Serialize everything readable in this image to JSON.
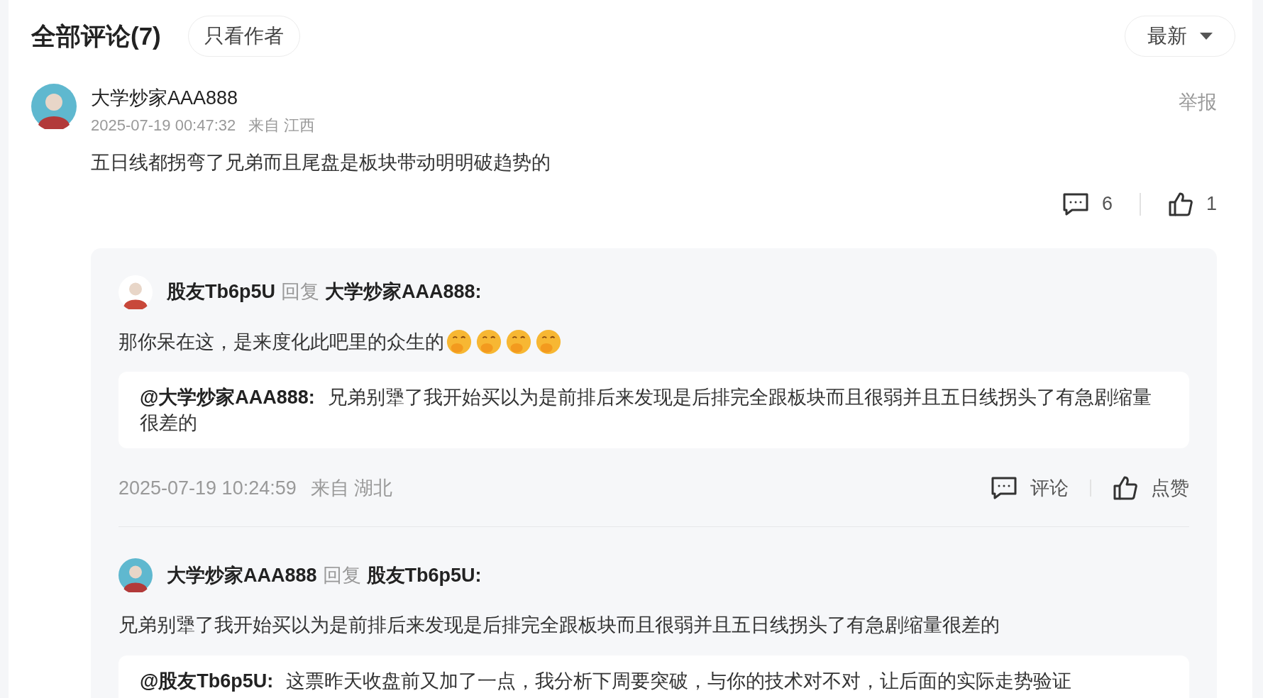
{
  "header": {
    "title": "全部评论(7)",
    "filter_button": "只看作者",
    "sort_button": "最新"
  },
  "comment": {
    "avatar": {
      "kind": "elder"
    },
    "author": "大学炒家AAA888",
    "time": "2025-07-19 00:47:32",
    "location": "来自 江西",
    "report": "举报",
    "text": "五日线都拐弯了兄弟而且尾盘是板块带动明明破趋势的",
    "reply_count": "6",
    "like_count": "1",
    "replies": [
      {
        "avatar": {
          "kind": "mascot"
        },
        "author": "股友Tb6p5U",
        "reply_word": "回复",
        "target": "大学炒家AAA888:",
        "text": "那你呆在这，是来度化此吧里的众生的",
        "emojis": [
          {
            "kind": "hand-over-mouth"
          },
          {
            "kind": "hand-over-mouth"
          },
          {
            "kind": "hand-over-mouth"
          },
          {
            "kind": "hand-over-mouth"
          }
        ],
        "quote": {
          "author": "@大学炒家AAA888:",
          "text": "兄弟别犟了我开始买以为是前排后来发现是后排完全跟板块而且很弱并且五日线拐头了有急剧缩量很差的"
        },
        "time": "2025-07-19 10:24:59",
        "location": "来自 湖北",
        "comment_label": "评论",
        "like_label": "点赞"
      },
      {
        "avatar": {
          "kind": "elder"
        },
        "author": "大学炒家AAA888",
        "reply_word": "回复",
        "target": "股友Tb6p5U:",
        "text": "兄弟别犟了我开始买以为是前排后来发现是后排完全跟板块而且很弱并且五日线拐头了有急剧缩量很差的",
        "quote": {
          "author": "@股友Tb6p5U:",
          "text": "这票昨天收盘前又加了一点，我分析下周要突破，与你的技术对不对，让后面的实际走势验证"
        }
      }
    ]
  }
}
